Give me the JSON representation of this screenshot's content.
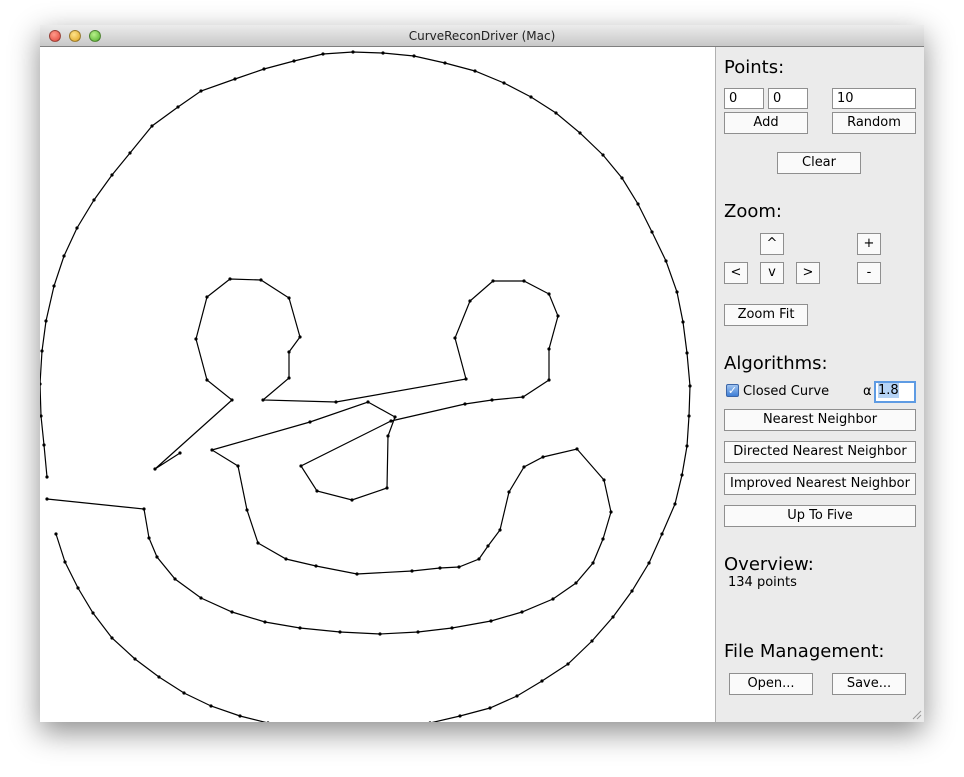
{
  "window": {
    "title": "CurveReconDriver (Mac)"
  },
  "points_section": {
    "heading": "Points:",
    "x_value": "0",
    "y_value": "0",
    "count_value": "10",
    "add_label": "Add",
    "random_label": "Random",
    "clear_label": "Clear"
  },
  "zoom_section": {
    "heading": "Zoom:",
    "up_label": "^",
    "left_label": "<",
    "down_label": "v",
    "right_label": ">",
    "zoom_in_label": "+",
    "zoom_out_label": "-",
    "zoom_fit_label": "Zoom Fit"
  },
  "algorithms_section": {
    "heading": "Algorithms:",
    "closed_curve_label": "Closed Curve",
    "closed_curve_checked": true,
    "alpha_symbol": "α",
    "alpha_value": "1.8",
    "nearest_neighbor_label": "Nearest Neighbor",
    "directed_nearest_neighbor_label": "Directed Nearest Neighbor",
    "improved_nearest_neighbor_label": "Improved Nearest Neighbor",
    "up_to_five_label": "Up To Five"
  },
  "overview_section": {
    "heading": "Overview:",
    "points_count": "134 points"
  },
  "file_section": {
    "heading": "File Management:",
    "open_label": "Open...",
    "save_label": "Save..."
  },
  "colors": {
    "curve": "#000000",
    "canvas_background": "#ffffff",
    "panel_background": "#ebebeb",
    "focus_ring": "#5e9be3"
  }
}
